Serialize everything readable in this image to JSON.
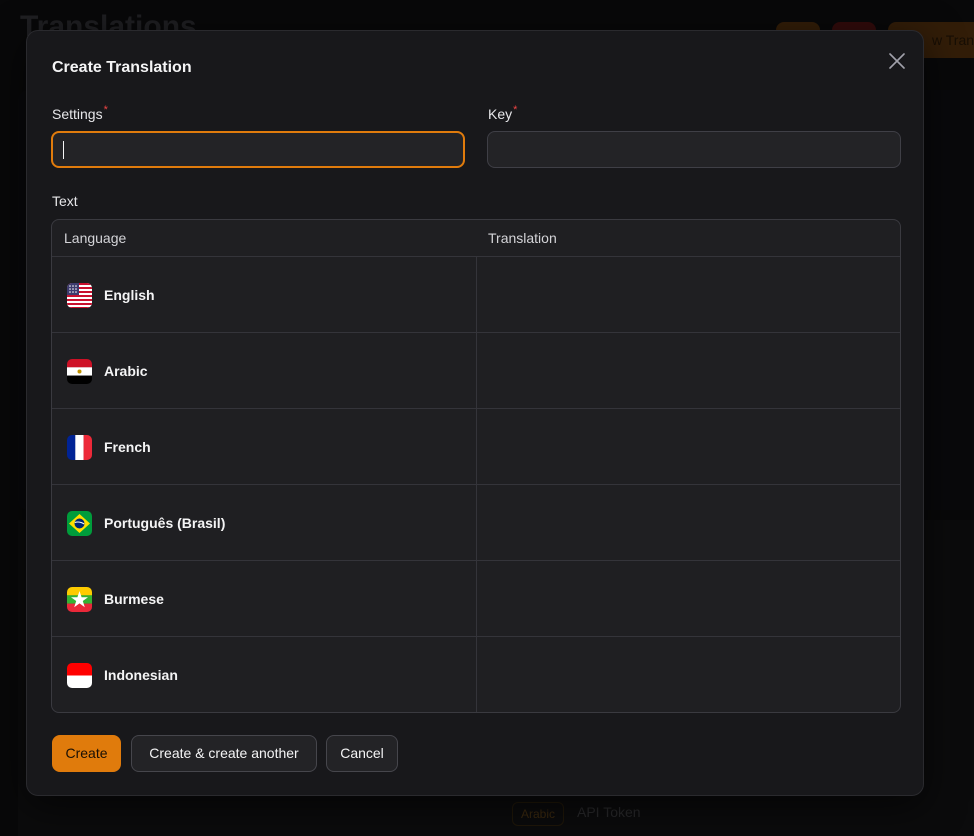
{
  "background": {
    "page_title": "Translations",
    "header_button_partial": "w Transl",
    "row_badge": "Arabic",
    "row_text": "API Token"
  },
  "modal": {
    "title": "Create Translation",
    "fields": {
      "settings": {
        "label": "Settings",
        "required_mark": "*",
        "value": ""
      },
      "key": {
        "label": "Key",
        "required_mark": "*",
        "value": ""
      }
    },
    "text_section": {
      "label": "Text",
      "columns": [
        "Language",
        "Translation"
      ],
      "rows": [
        {
          "language": "English",
          "flag": "us-flag-icon",
          "translation": ""
        },
        {
          "language": "Arabic",
          "flag": "egypt-flag-icon",
          "translation": ""
        },
        {
          "language": "French",
          "flag": "france-flag-icon",
          "translation": ""
        },
        {
          "language": "Português (Brasil)",
          "flag": "brazil-flag-icon",
          "translation": ""
        },
        {
          "language": "Burmese",
          "flag": "myanmar-flag-icon",
          "translation": ""
        },
        {
          "language": "Indonesian",
          "flag": "indonesia-flag-icon",
          "translation": ""
        }
      ]
    },
    "buttons": {
      "create": "Create",
      "create_another": "Create & create another",
      "cancel": "Cancel"
    }
  },
  "colors": {
    "accent": "#e07b0c",
    "required": "#ef4444",
    "modal_bg": "#18181b"
  }
}
